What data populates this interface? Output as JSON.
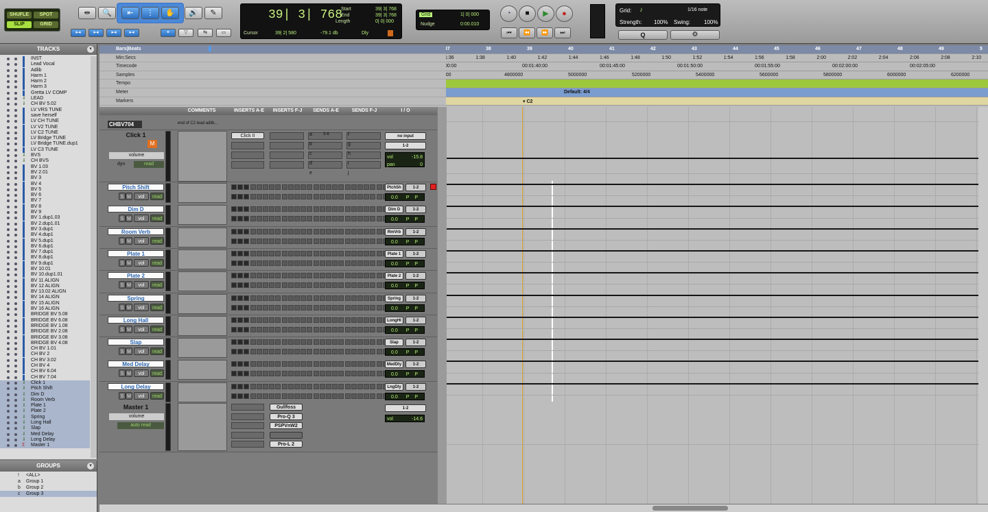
{
  "toolbar": {
    "modes": [
      "SHUFLE",
      "SPOT",
      "SLIP",
      "GRID"
    ],
    "counter": "39| 3| 768",
    "start_label": "Start",
    "end_label": "End",
    "length_label": "Length",
    "start": "39| 3| 768",
    "end": "39| 3| 768",
    "length": "0| 0| 000",
    "cursor_label": "Cursor",
    "cursor": "39| 2| 580",
    "cursor_db": "-79.1 db",
    "dly": "Dly",
    "grid_label": "Grid",
    "grid_value": "1| 0| 000",
    "nudge_label": "Nudge",
    "nudge_value": "0:00.010",
    "quant_grid_label": "Grid:",
    "quant_note": "1/16 note",
    "strength_label": "Strength:",
    "strength": "100%",
    "swing_label": "Swing:",
    "swing": "100%",
    "q_label": "Q",
    "settings": "gear-icon"
  },
  "tracks_panel": {
    "title": "TRACKS",
    "tracks": [
      "INST",
      "Lead Vocal",
      "Adlib",
      "Harm 1",
      "Harm 2",
      "Harm 3",
      "Gretta LV COMP",
      "LEAD",
      "CH BV 5.02",
      "LV VRS TUNE",
      "save herself",
      "LV CH TUNE",
      "LV V2 TUNE",
      "LV C2 TUNE",
      "LV Bridge TUNE",
      "LV Bridge TUNE.dup1",
      "LV C3 TUNE",
      "BVS",
      "CH BVS",
      "BV 1.03",
      "BV 2.01",
      "BV 3",
      "BV 4",
      "BV 5",
      "BV 6",
      "BV 7",
      "BV 8",
      "BV 9",
      "BV 1.dup1.03",
      "BV 2.dup1.01",
      "BV 3.dup1",
      "BV 4.dup1",
      "BV 5.dup1",
      "BV 6.dup1",
      "BV 7.dup1",
      "BV 8.dup1",
      "BV 9.dup1",
      "BV 10.01",
      "BV 10.dup1.01",
      "BV 11 ALIGN",
      "BV 12 ALIGN",
      "BV 13.02 ALIGN",
      "BV 14 ALIGN",
      "BV 15 ALIGN",
      "BV 16 ALIGN",
      "BRIDGE BV 5.08",
      "BRIDGE BV 6.08",
      "BRIDGE BV 1.08",
      "BRIDGE BV 2.08",
      "BRIDGE BV 3.08",
      "BRIDGE BV 4.08",
      "CH BV 1.01",
      "CH BV 2",
      "CH BV 3.02",
      "CH BV 4",
      "CH BV 6.04",
      "CH BV 7.04",
      "Click 1",
      "Pitch Shift",
      "Dim D",
      "Room Verb",
      "Plate 1",
      "Plate 2",
      "Spring",
      "Long Hall",
      "Slap",
      "Med Delay",
      "Long Delay",
      "Master 1"
    ]
  },
  "groups_panel": {
    "title": "GROUPS",
    "groups": [
      {
        "letter": "!",
        "name": "<ALL>"
      },
      {
        "letter": "a",
        "name": "Group 1"
      },
      {
        "letter": "b",
        "name": "Group 2"
      },
      {
        "letter": "c",
        "name": "Group 3"
      }
    ]
  },
  "rulers": {
    "names": [
      "Bars|Beats",
      "Min:Secs",
      "Timecode",
      "Samples",
      "Tempo",
      "Meter",
      "Markers"
    ],
    "bars": [
      "37",
      "38",
      "39",
      "40",
      "41",
      "42",
      "43",
      "44",
      "45",
      "46",
      "47",
      "48",
      "49",
      "5"
    ],
    "minsecs": [
      "1:36",
      "1:38",
      "1:40",
      "1:42",
      "1:44",
      "1:46",
      "1:48",
      "1:50",
      "1:52",
      "1:54",
      "1:56",
      "1:58",
      "2:00",
      "2:02",
      "2:04",
      "2:06",
      "2:08",
      "2:10"
    ],
    "timecode": [
      "00:00",
      "00:01:40:00",
      "00:01:45:00",
      "00:01:50:00",
      "00:01:55:00",
      "00:02:00:00",
      "00:02:05:00",
      "00:02"
    ],
    "samples": [
      "0000",
      "4800000",
      "5000000",
      "5200000",
      "5400000",
      "5600000",
      "5800000",
      "6000000",
      "6200000"
    ],
    "meter_text": "Default: 4/4",
    "marker_text": "C2"
  },
  "mix": {
    "headers": [
      "COMMENTS",
      "INSERTS A-E",
      "INSERTS F-J",
      "SENDS A-E",
      "SENDS F-J",
      "I / O"
    ],
    "top_track": "CHBV704",
    "top_comment": "end of C2 lead adlib...",
    "click": {
      "name": "Click 1",
      "volume": "volume",
      "dyn": "dyn",
      "read": "read",
      "insert": "Click II",
      "io_in": "no input",
      "io_out": "1-2",
      "vol_label": "vol",
      "vol": "-15.8",
      "pan_label": "pan",
      "pan": "0",
      "sends": [
        "a",
        "b",
        "c",
        "d",
        "e",
        "f",
        "g",
        "h",
        "i",
        "j"
      ],
      "send_a_val": "3-6"
    },
    "channels": [
      {
        "name": "Pitch Shift",
        "io": "PtchSh",
        "out": "1-2"
      },
      {
        "name": "Dim D",
        "io": "Dim D",
        "out": "1-2"
      },
      {
        "name": "Room Verb",
        "io": "RmVrb",
        "out": "1-2"
      },
      {
        "name": "Plate 1",
        "io": "Plate 1",
        "out": "1-2"
      },
      {
        "name": "Plate 2",
        "io": "Plate 2",
        "out": "1-2"
      },
      {
        "name": "Spring",
        "io": "Spring",
        "out": "1-2"
      },
      {
        "name": "Long Hall",
        "io": "LongHl",
        "out": "1-2"
      },
      {
        "name": "Slap",
        "io": "Slap",
        "out": "1-2"
      },
      {
        "name": "Med Delay",
        "io": "MedDly",
        "out": "1-2"
      },
      {
        "name": "Long Delay",
        "io": "LngDly",
        "out": "1-2"
      }
    ],
    "ch_labels": {
      "s": "S",
      "m": "M",
      "vol": "vol",
      "read": "read",
      "lcd": "0.0",
      "p": "P"
    },
    "master": {
      "name": "Master 1",
      "volume": "volume",
      "mode": "auto read",
      "inserts": [
        "Gullfoss",
        "Pro-Q 3",
        "PSPVnW2",
        "",
        "Pro-L 2"
      ],
      "out": "1-2",
      "vol_label": "vol",
      "vol": "-14.6"
    }
  }
}
